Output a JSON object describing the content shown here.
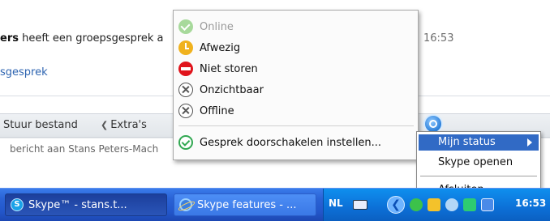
{
  "chat": {
    "message_sender_partial": "ers",
    "message_text": " heeft een groepsgesprek a",
    "message_time": "16:53",
    "call_link": "sgesprek",
    "toolbar_send": "Stuur bestand",
    "toolbar_extras": "Extra's",
    "input_placeholder": "bericht aan Stans Peters-Mach"
  },
  "status_menu": {
    "items": [
      {
        "label": "Online",
        "icon": "online-icon",
        "disabled": true
      },
      {
        "label": "Afwezig",
        "icon": "away-icon"
      },
      {
        "label": "Niet storen",
        "icon": "do-not-disturb-icon"
      },
      {
        "label": "Onzichtbaar",
        "icon": "invisible-icon"
      },
      {
        "label": "Offline",
        "icon": "offline-icon"
      }
    ],
    "forward_label": "Gesprek doorschakelen instellen..."
  },
  "tray_menu": {
    "my_status": "Mijn status",
    "open_skype": "Skype openen",
    "quit": "Afsluiten"
  },
  "taskbar": {
    "buttons": [
      {
        "label": "Skype™ - stans.t...",
        "icon": "skype-icon",
        "active": true
      },
      {
        "label": "Skype features - ...",
        "icon": "internet-explorer-icon",
        "active": false
      }
    ],
    "language": "NL",
    "clock": "16:53"
  },
  "colors": {
    "menu_highlight": "#316ac5",
    "taskbar_blue": "#2357cb",
    "tray_blue": "#0c6fd6",
    "link_blue": "#2c63b0"
  }
}
